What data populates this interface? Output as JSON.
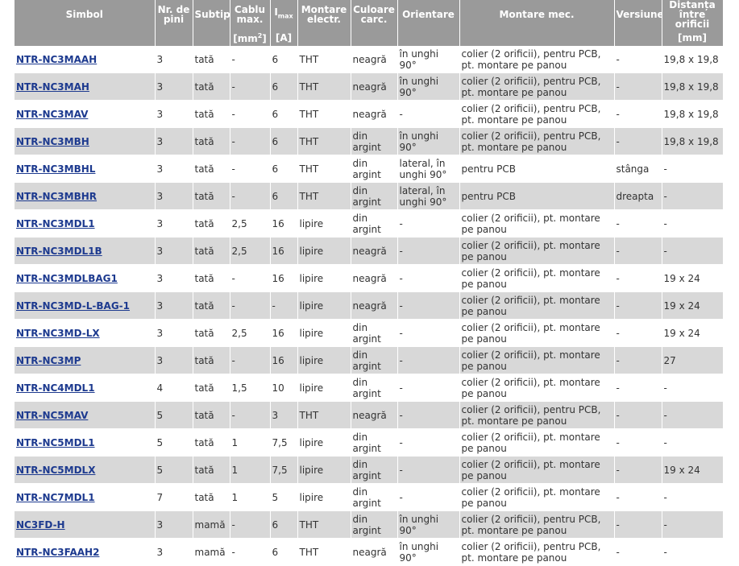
{
  "headers": {
    "symbol": "Simbol",
    "pins": "Nr. de pini",
    "subtype": "Subtip",
    "cable_max": "Cablu max.",
    "imax": "Imax",
    "electrical_mounting": "Montare electr.",
    "housing_color": "Culoare carc.",
    "orientation": "Orientare",
    "mechanical_mounting": "Montare mec.",
    "version": "Versiune",
    "hole_spacing": "Distanța între orificii",
    "unit_cable": "[mm2]",
    "unit_imax": "[A]",
    "unit_spacing": "[mm]"
  },
  "rows": [
    {
      "symbol": "NTR-NC3MAAH",
      "pins": "3",
      "subtype": "tată",
      "cable": "-",
      "imax": "6",
      "el": "THT",
      "color": "neagră",
      "orient": "în unghi 90°",
      "mech": "colier (2 orificii), pentru PCB, pt. montare pe panou",
      "version": "-",
      "spacing": "19,8 x 19,8"
    },
    {
      "symbol": "NTR-NC3MAH",
      "pins": "3",
      "subtype": "tată",
      "cable": "-",
      "imax": "6",
      "el": "THT",
      "color": "neagră",
      "orient": "în unghi 90°",
      "mech": "colier (2 orificii), pentru PCB, pt. montare pe panou",
      "version": "-",
      "spacing": "19,8 x 19,8"
    },
    {
      "symbol": "NTR-NC3MAV",
      "pins": "3",
      "subtype": "tată",
      "cable": "-",
      "imax": "6",
      "el": "THT",
      "color": "neagră",
      "orient": "-",
      "mech": "colier (2 orificii), pentru PCB, pt. montare pe panou",
      "version": "-",
      "spacing": "19,8 x 19,8"
    },
    {
      "symbol": "NTR-NC3MBH",
      "pins": "3",
      "subtype": "tată",
      "cable": "-",
      "imax": "6",
      "el": "THT",
      "color": "din argint",
      "orient": "în unghi 90°",
      "mech": "colier (2 orificii), pentru PCB, pt. montare pe panou",
      "version": "-",
      "spacing": "19,8 x 19,8"
    },
    {
      "symbol": "NTR-NC3MBHL",
      "pins": "3",
      "subtype": "tată",
      "cable": "-",
      "imax": "6",
      "el": "THT",
      "color": "din argint",
      "orient": "lateral, în unghi 90°",
      "mech": "pentru PCB",
      "version": "stânga",
      "spacing": "-"
    },
    {
      "symbol": "NTR-NC3MBHR",
      "pins": "3",
      "subtype": "tată",
      "cable": "-",
      "imax": "6",
      "el": "THT",
      "color": "din argint",
      "orient": "lateral, în unghi 90°",
      "mech": "pentru PCB",
      "version": "dreapta",
      "spacing": "-"
    },
    {
      "symbol": "NTR-NC3MDL1",
      "pins": "3",
      "subtype": "tată",
      "cable": "2,5",
      "imax": "16",
      "el": "lipire",
      "color": "din argint",
      "orient": "-",
      "mech": "colier (2 orificii), pt. montare pe panou",
      "version": "-",
      "spacing": "-"
    },
    {
      "symbol": "NTR-NC3MDL1B",
      "pins": "3",
      "subtype": "tată",
      "cable": "2,5",
      "imax": "16",
      "el": "lipire",
      "color": "neagră",
      "orient": "-",
      "mech": "colier (2 orificii), pt. montare pe panou",
      "version": "-",
      "spacing": "-"
    },
    {
      "symbol": "NTR-NC3MDLBAG1",
      "pins": "3",
      "subtype": "tată",
      "cable": "-",
      "imax": "16",
      "el": "lipire",
      "color": "neagră",
      "orient": "-",
      "mech": "colier (2 orificii), pt. montare pe panou",
      "version": "-",
      "spacing": "19 x 24"
    },
    {
      "symbol": "NTR-NC3MD-L-BAG-1",
      "pins": "3",
      "subtype": "tată",
      "cable": "-",
      "imax": "-",
      "el": "lipire",
      "color": "neagră",
      "orient": "-",
      "mech": "colier (2 orificii), pt. montare pe panou",
      "version": "-",
      "spacing": "19 x 24"
    },
    {
      "symbol": "NTR-NC3MD-LX",
      "pins": "3",
      "subtype": "tată",
      "cable": "2,5",
      "imax": "16",
      "el": "lipire",
      "color": "din argint",
      "orient": "-",
      "mech": "colier (2 orificii), pt. montare pe panou",
      "version": "-",
      "spacing": "19 x 24"
    },
    {
      "symbol": "NTR-NC3MP",
      "pins": "3",
      "subtype": "tată",
      "cable": "-",
      "imax": "16",
      "el": "lipire",
      "color": "din argint",
      "orient": "-",
      "mech": "colier (2 orificii), pt. montare pe panou",
      "version": "-",
      "spacing": "27"
    },
    {
      "symbol": "NTR-NC4MDL1",
      "pins": "4",
      "subtype": "tată",
      "cable": "1,5",
      "imax": "10",
      "el": "lipire",
      "color": "din argint",
      "orient": "-",
      "mech": "colier (2 orificii), pt. montare pe panou",
      "version": "-",
      "spacing": "-"
    },
    {
      "symbol": "NTR-NC5MAV",
      "pins": "5",
      "subtype": "tată",
      "cable": "-",
      "imax": "3",
      "el": "THT",
      "color": "neagră",
      "orient": "-",
      "mech": "colier (2 orificii), pentru PCB, pt. montare pe panou",
      "version": "-",
      "spacing": "-"
    },
    {
      "symbol": "NTR-NC5MDL1",
      "pins": "5",
      "subtype": "tată",
      "cable": "1",
      "imax": "7,5",
      "el": "lipire",
      "color": "din argint",
      "orient": "-",
      "mech": "colier (2 orificii), pt. montare pe panou",
      "version": "-",
      "spacing": "-"
    },
    {
      "symbol": "NTR-NC5MDLX",
      "pins": "5",
      "subtype": "tată",
      "cable": "1",
      "imax": "7,5",
      "el": "lipire",
      "color": "din argint",
      "orient": "-",
      "mech": "colier (2 orificii), pt. montare pe panou",
      "version": "-",
      "spacing": "19 x 24"
    },
    {
      "symbol": "NTR-NC7MDL1",
      "pins": "7",
      "subtype": "tată",
      "cable": "1",
      "imax": "5",
      "el": "lipire",
      "color": "din argint",
      "orient": "-",
      "mech": "colier (2 orificii), pt. montare pe panou",
      "version": "-",
      "spacing": "-"
    },
    {
      "symbol": "NC3FD-H",
      "pins": "3",
      "subtype": "mamă",
      "cable": "-",
      "imax": "6",
      "el": "THT",
      "color": "din argint",
      "orient": "în unghi 90°",
      "mech": "colier (2 orificii), pentru PCB, pt. montare pe panou",
      "version": "-",
      "spacing": "-"
    },
    {
      "symbol": "NTR-NC3FAAH2",
      "pins": "3",
      "subtype": "mamă",
      "cable": "-",
      "imax": "6",
      "el": "THT",
      "color": "neagră",
      "orient": "în unghi 90°",
      "mech": "colier (2 orificii), pentru PCB, pt. montare pe panou",
      "version": "-",
      "spacing": "-"
    }
  ],
  "colors": {
    "header_bg": "#9a9a9a",
    "subheader_bg": "#b4b4b4",
    "row_alt_bg": "#d8d8d8",
    "link": "#1d3a8f"
  }
}
